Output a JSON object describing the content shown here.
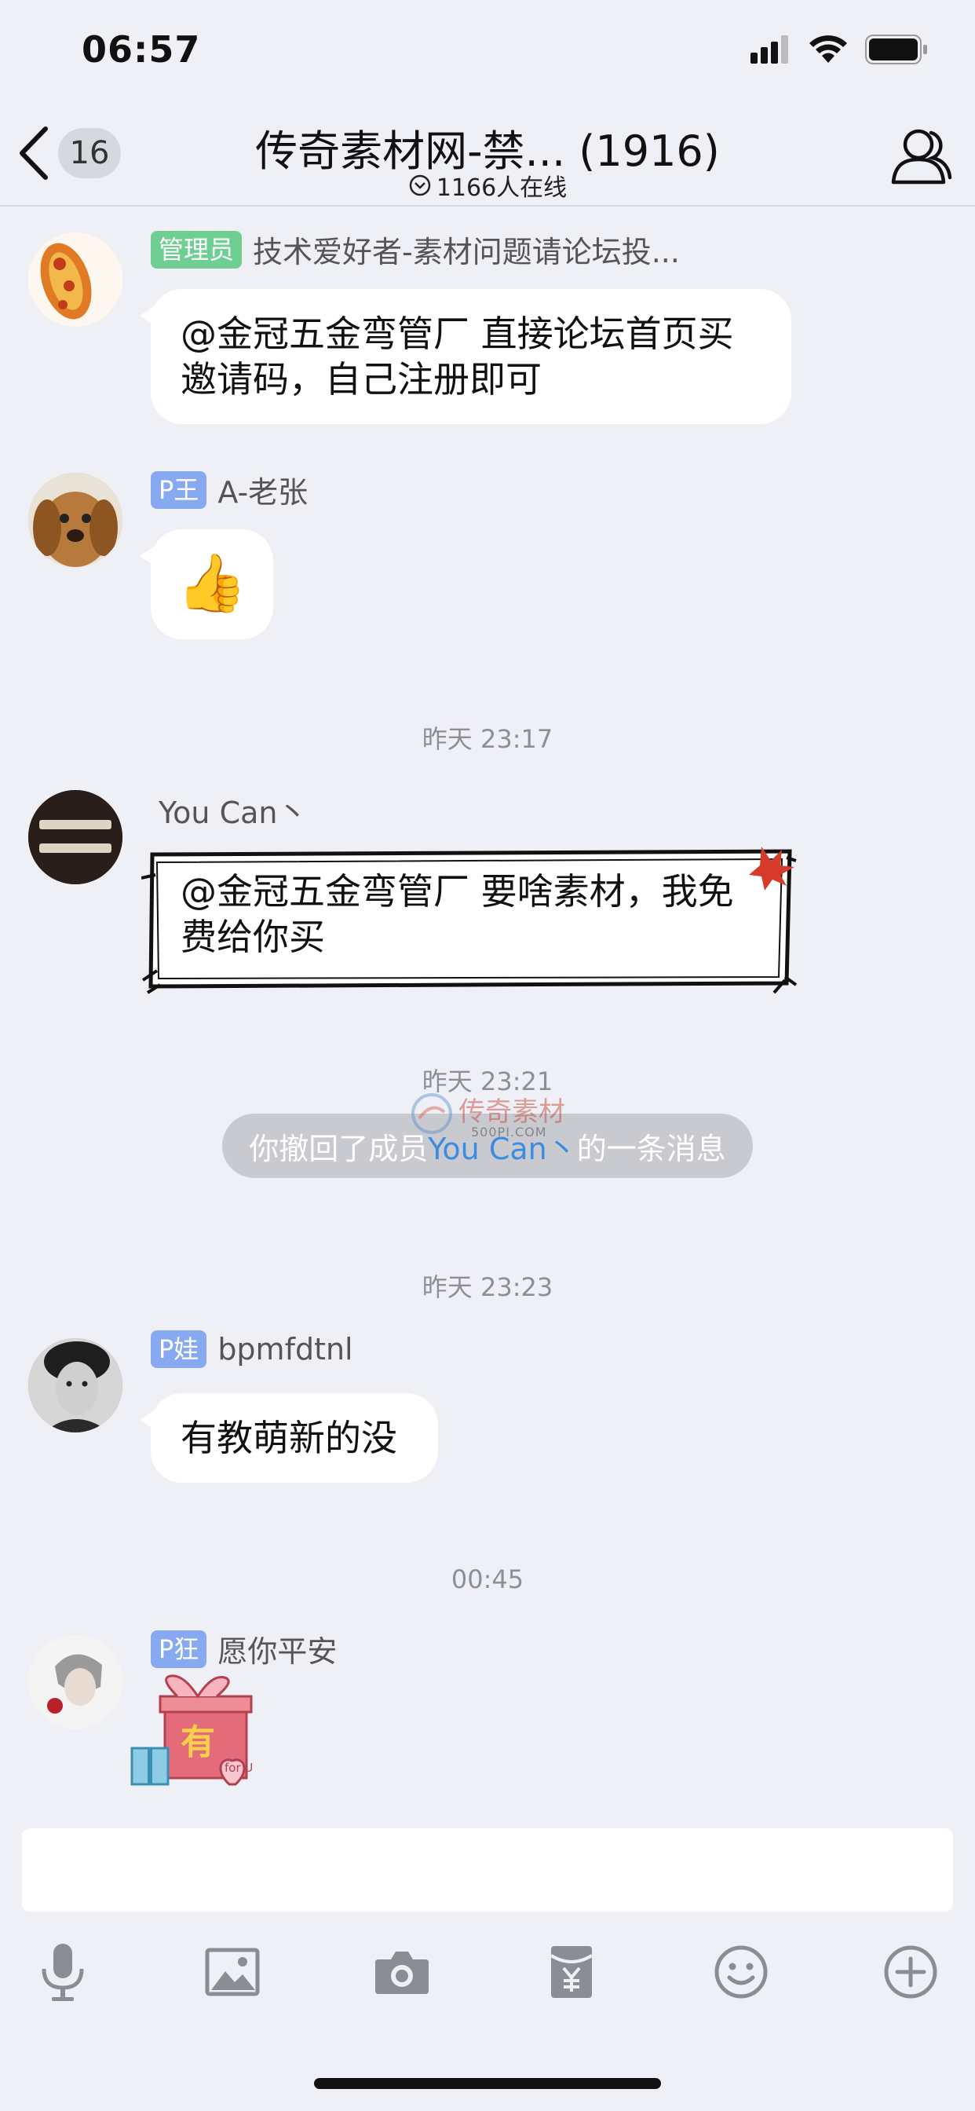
{
  "status": {
    "time": "06:57"
  },
  "nav": {
    "badge": "16",
    "title": "传奇素材网-禁... (1916)",
    "online": "1166人在线"
  },
  "messages": [
    {
      "tag": "管理员",
      "sender": "技术爱好者-素材问题请论坛投...",
      "text": "@金冠五金弯管厂 直接论坛首页买邀请码，自己注册即可"
    },
    {
      "tag": "P王",
      "sender": "A-老张",
      "emoji": "👍"
    },
    {
      "sender": "You Can丶",
      "text": "@金冠五金弯管厂 要啥素材，我免费给你买"
    },
    {
      "tag": "P娃",
      "sender": "bpmfdtnl",
      "text": "有教萌新的没"
    },
    {
      "tag": "P狂",
      "sender": "愿你平安",
      "sticker_text": "有",
      "sticker_sub": "for U"
    }
  ],
  "times": [
    "昨天 23:17",
    "昨天 23:21",
    "昨天 23:23",
    "00:45"
  ],
  "recall": {
    "prefix": "你撤回了成员",
    "name": "You Can丶",
    "suffix": "的一条消息"
  },
  "watermark": {
    "text": "传奇素材",
    "sub": "500PI.COM"
  },
  "toolbar": [
    "mic-icon",
    "image-icon",
    "camera-icon",
    "red-packet-icon",
    "emoji-icon",
    "plus-icon"
  ]
}
